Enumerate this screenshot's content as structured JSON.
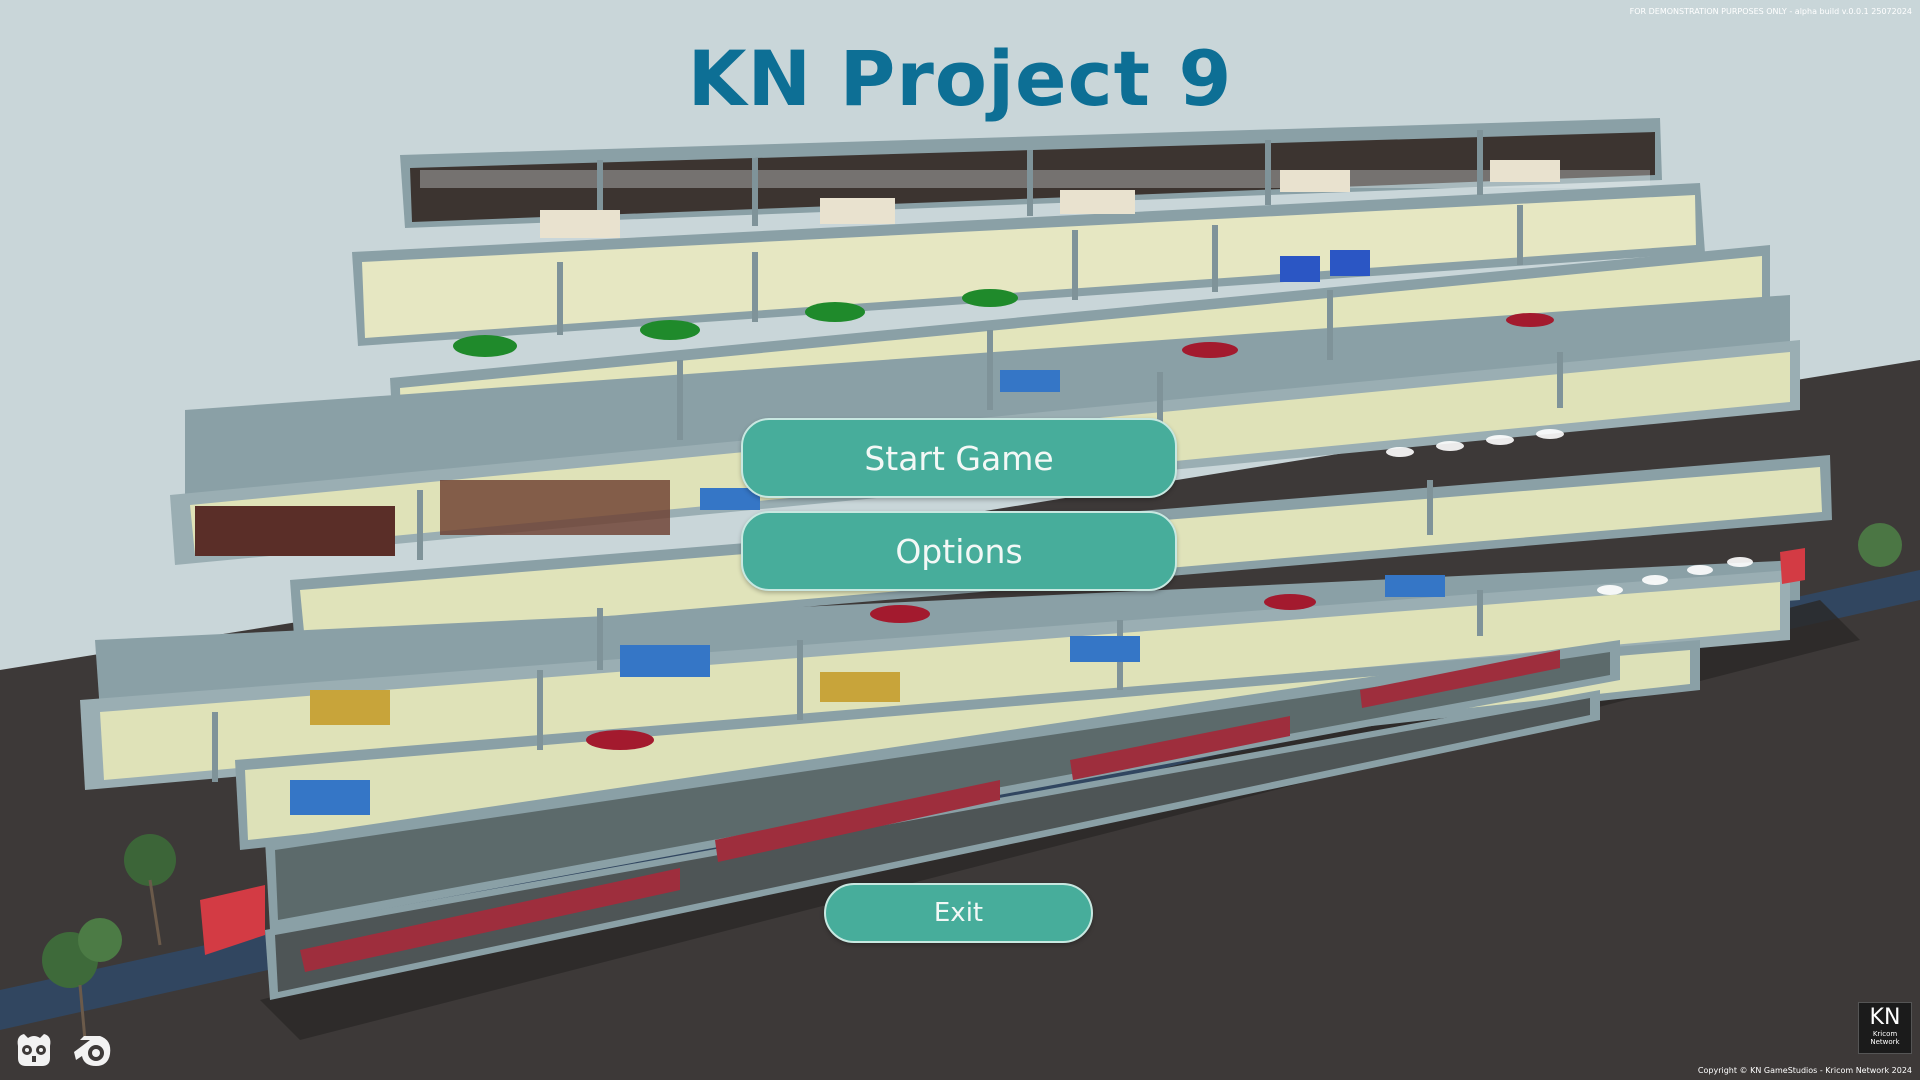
{
  "title": "KN Project 9",
  "menu": {
    "start_label": "Start Game",
    "options_label": "Options",
    "exit_label": "Exit"
  },
  "build_notice": "FOR DEMONSTRATION PURPOSES ONLY - alpha build v.0.0.1 25072024",
  "copyright": "Copyright © KN GameStudios - Kricom Network 2024",
  "logo": {
    "big": "KN",
    "small_line1": "Kricom",
    "small_line2": "Network"
  },
  "icons": [
    "godot-engine-icon",
    "blender-icon",
    "kn-logo-icon"
  ],
  "colors": {
    "title": "#0d6f95",
    "button": "#47ad9b",
    "sky": "#c9d6d9",
    "ground": "#3f3b3a"
  }
}
